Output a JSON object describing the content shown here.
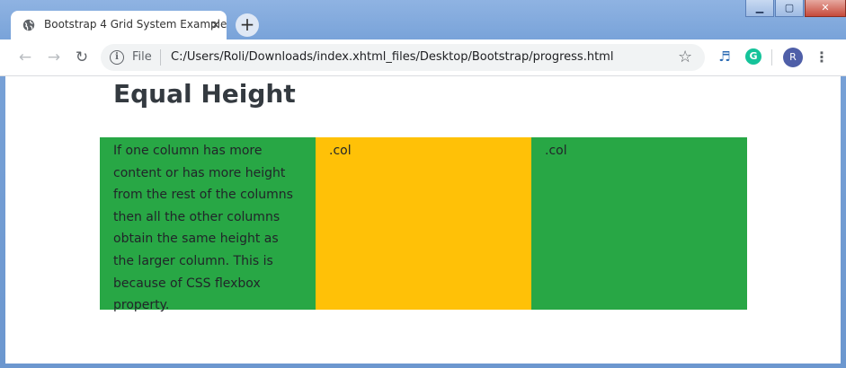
{
  "browser": {
    "tab_title": "Bootstrap 4 Grid System Example",
    "tab_close": "×",
    "new_tab": "+",
    "file_label": "File",
    "url": "C:/Users/Roli/Downloads/index.xhtml_files/Desktop/Bootstrap/progress.html",
    "profile_initial": "R",
    "window_controls": {
      "minimize": "▁",
      "maximize": "▢",
      "close": "✕"
    }
  },
  "page": {
    "heading": "Equal Height",
    "columns": [
      {
        "text": "If one column has more content or has more height from the rest of the columns then all the other columns obtain the same height as the larger column. This is because of CSS flexbox property.",
        "background": "#28a745"
      },
      {
        "text": ".col",
        "background": "#ffc107"
      },
      {
        "text": ".col",
        "background": "#28a745"
      }
    ]
  },
  "icons": {
    "tab": "globe-icon",
    "back": "back-arrow-icon",
    "forward": "forward-arrow-icon",
    "reload": "reload-icon",
    "info": "info-icon",
    "bookmark": "star-icon",
    "extension_1": "extension-icon",
    "extension_2": "grammarly-icon",
    "menu": "more-vert-icon"
  }
}
